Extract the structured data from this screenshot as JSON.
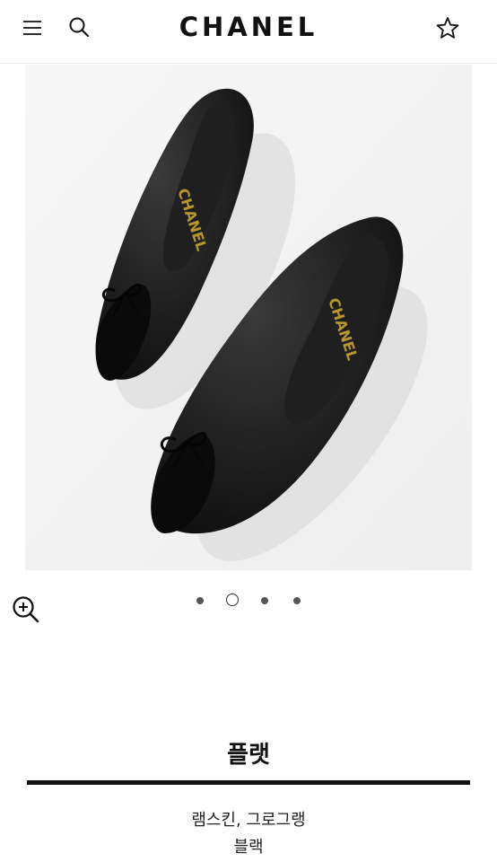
{
  "header": {
    "logo": "CHANEL",
    "icons": [
      "menu-icon",
      "search-icon",
      "star-icon"
    ]
  },
  "product": {
    "image_label": "CHANEL",
    "carousel": {
      "total": 4,
      "active_index": 2
    },
    "title": "플랫",
    "material": "램스킨, 그로그랭",
    "color": "블랙"
  },
  "colors": {
    "text": "#111111",
    "image_bg": "#f5f5f5",
    "shoe": "#161616",
    "lining_text": "#b8962e"
  }
}
